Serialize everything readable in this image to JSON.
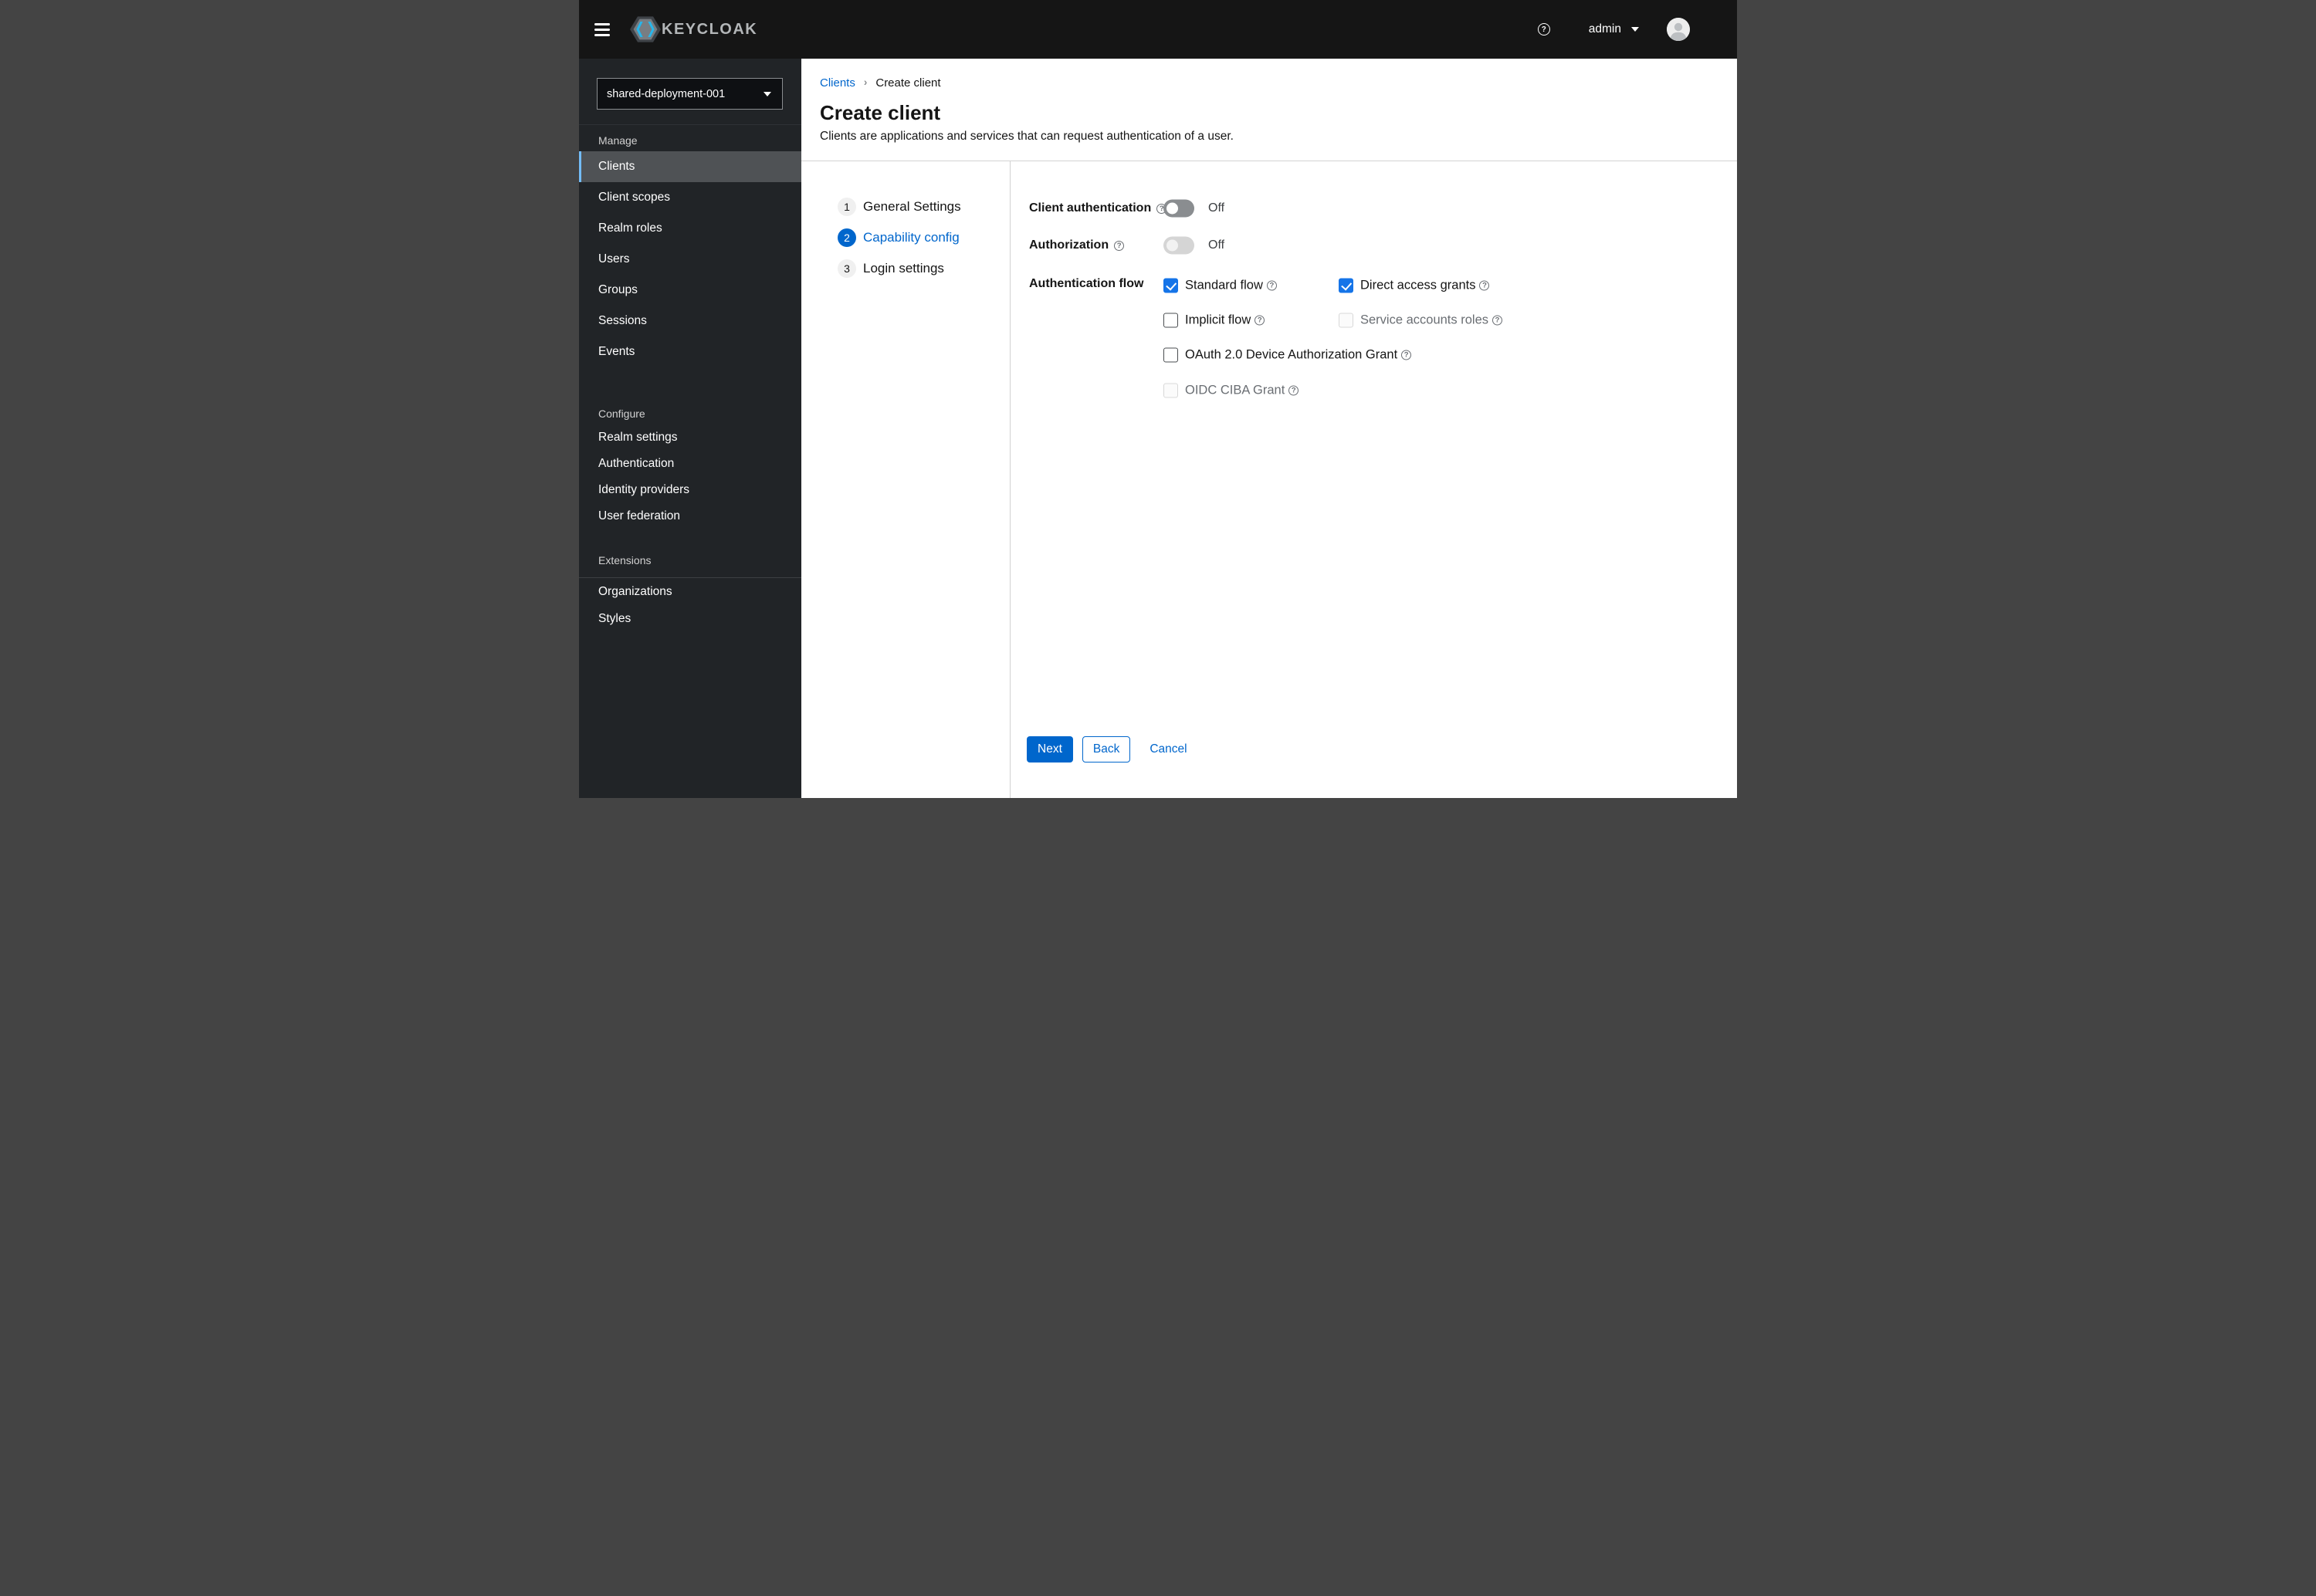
{
  "colors": {
    "header_bg": "#151515",
    "sidebar_bg": "#212427",
    "nav_selected_bg": "#4f5255",
    "nav_selected_border": "#73bcf7",
    "primary_blue": "#0066cc",
    "checkbox_checked_blue": "#1574e8",
    "divider_gray": "#d2d2d2",
    "disabled_text_gray": "#6a6e73"
  },
  "header": {
    "brand": "KEYCLOAK",
    "icons": {
      "menu": "hamburger-menu-icon",
      "help": "question-circle-icon",
      "user_caret": "caret-down-icon",
      "avatar": "user-avatar-icon"
    },
    "user": {
      "label": "admin"
    }
  },
  "sidebar": {
    "realm_selector": {
      "value": "shared-deployment-001",
      "icon": "caret-down-icon"
    },
    "groups": [
      {
        "label": "Manage",
        "items": [
          {
            "label": "Clients",
            "active": true
          },
          {
            "label": "Client scopes",
            "active": false
          },
          {
            "label": "Realm roles",
            "active": false
          },
          {
            "label": "Users",
            "active": false
          },
          {
            "label": "Groups",
            "active": false
          },
          {
            "label": "Sessions",
            "active": false
          },
          {
            "label": "Events",
            "active": false
          }
        ]
      },
      {
        "label": "Configure",
        "items": [
          {
            "label": "Realm settings",
            "active": false
          },
          {
            "label": "Authentication",
            "active": false
          },
          {
            "label": "Identity providers",
            "active": false
          },
          {
            "label": "User federation",
            "active": false
          }
        ]
      },
      {
        "label": "Extensions",
        "items": [
          {
            "label": "Organizations",
            "active": false
          },
          {
            "label": "Styles",
            "active": false
          }
        ]
      }
    ]
  },
  "breadcrumb": {
    "items": [
      {
        "label": "Clients",
        "link": true
      },
      {
        "label": "Create client",
        "link": false
      }
    ],
    "separator_icon": "angle-right-icon"
  },
  "page": {
    "title": "Create client",
    "description": "Clients are applications and services that can request authentication of a user."
  },
  "wizard": {
    "steps": [
      {
        "number": "1",
        "label": "General Settings",
        "current": false
      },
      {
        "number": "2",
        "label": "Capability config",
        "current": true
      },
      {
        "number": "3",
        "label": "Login settings",
        "current": false
      }
    ],
    "form": {
      "client_authentication": {
        "label": "Client authentication",
        "value": "Off",
        "disabled": false,
        "help_icon": "question-circle-icon"
      },
      "authorization": {
        "label": "Authorization",
        "value": "Off",
        "disabled": true,
        "help_icon": "question-circle-icon"
      },
      "authentication_flow": {
        "label": "Authentication flow",
        "checkboxes": [
          {
            "label": "Standard flow",
            "checked": true,
            "disabled": false
          },
          {
            "label": "Direct access grants",
            "checked": true,
            "disabled": false
          },
          {
            "label": "Implicit flow",
            "checked": false,
            "disabled": false
          },
          {
            "label": "Service accounts roles",
            "checked": false,
            "disabled": true
          },
          {
            "label": "OAuth 2.0 Device Authorization Grant",
            "checked": false,
            "disabled": false
          },
          {
            "label": "OIDC CIBA Grant",
            "checked": false,
            "disabled": true
          }
        ]
      }
    },
    "footer": {
      "next_label": "Next",
      "back_label": "Back",
      "cancel_label": "Cancel"
    }
  }
}
